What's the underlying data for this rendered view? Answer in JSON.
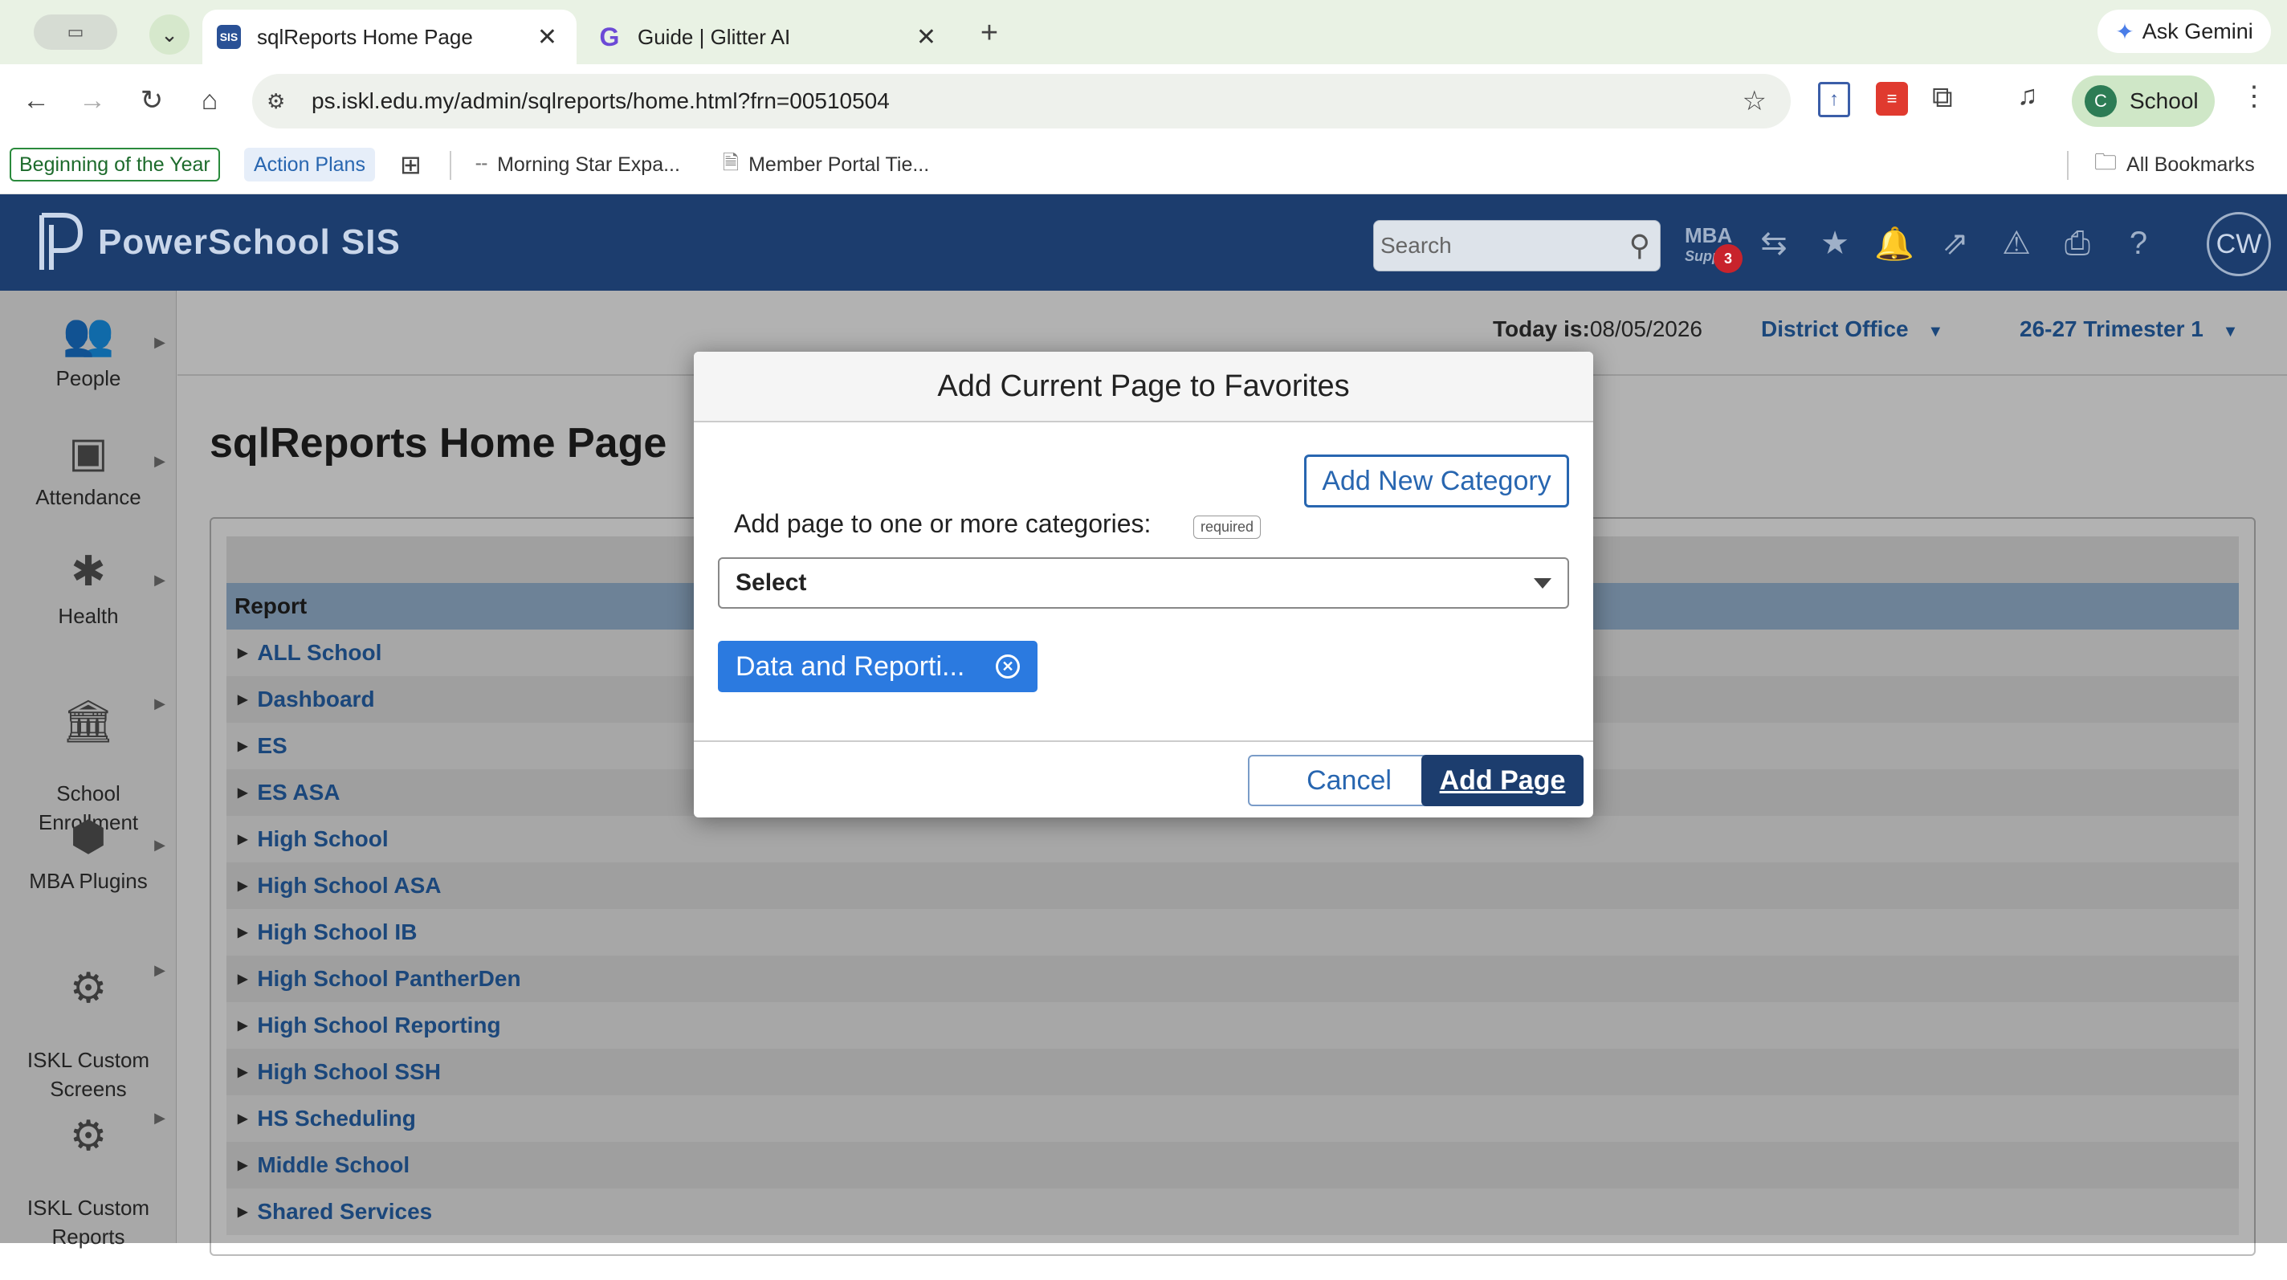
{
  "browser": {
    "tabs": [
      {
        "title": "sqlReports Home Page",
        "favicon": "SIS",
        "active": true
      },
      {
        "title": "Guide | Glitter AI",
        "favicon": "G",
        "active": false
      }
    ],
    "url": "ps.iskl.edu.my/admin/sqlreports/home.html?frn=00510504",
    "profile_label": "School",
    "profile_initial": "C",
    "ask_gemini": "Ask Gemini",
    "bookmarks": [
      "Beginning of the Year",
      "Action Plans",
      "Morning Star Expa...",
      "Member Portal Tie..."
    ],
    "all_bookmarks": "All Bookmarks"
  },
  "app": {
    "brand": "PowerSchool SIS",
    "search_placeholder": "Search",
    "mba_label": "MBA",
    "mba_sub": "Supp",
    "mba_badge": "3",
    "user_initials": "CW"
  },
  "sidebar": {
    "items": [
      {
        "label": "People",
        "icon": "people-icon"
      },
      {
        "label": "Attendance",
        "icon": "attendance-icon"
      },
      {
        "label": "Health",
        "icon": "health-icon"
      },
      {
        "label": "School\nEnrollment",
        "icon": "school-icon"
      },
      {
        "label": "MBA Plugins",
        "icon": "plugin-icon"
      },
      {
        "label": "ISKL Custom\nScreens",
        "icon": "custom-screens-icon"
      },
      {
        "label": "ISKL Custom\nReports",
        "icon": "custom-reports-icon"
      }
    ]
  },
  "main": {
    "today_label": "Today is:",
    "today_value": "08/05/2026",
    "school_select": "District Office",
    "term_select": "26-27 Trimester 1",
    "page_title": "sqlReports Home Page",
    "table_header": "Report",
    "rows": [
      "ALL School",
      "Dashboard",
      "ES",
      "ES ASA",
      "High School",
      "High School ASA",
      "High School IB",
      "High School PantherDen",
      "High School Reporting",
      "High School SSH",
      "HS Scheduling",
      "Middle School",
      "Shared Services"
    ]
  },
  "modal": {
    "title": "Add Current Page to Favorites",
    "add_category_label": "Add New Category",
    "prompt": "Add page to one or more categories:",
    "required_label": "required",
    "select_value": "Select",
    "chip_label": "Data and Reporti...",
    "cancel_label": "Cancel",
    "add_page_label": "Add Page"
  }
}
